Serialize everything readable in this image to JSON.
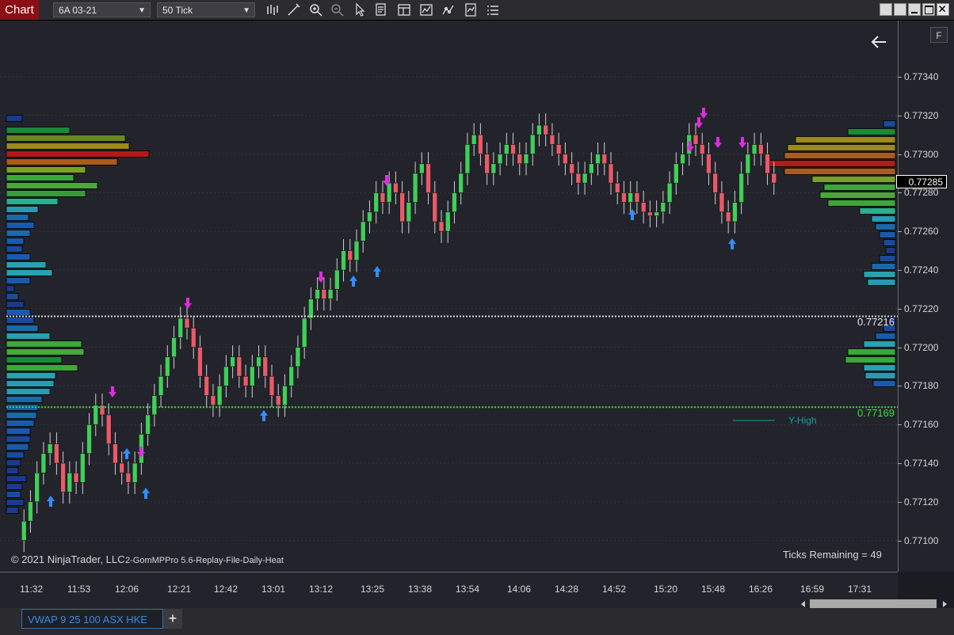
{
  "toolbar": {
    "chart_tab": "Chart",
    "instrument": "6A 03-21",
    "period": "50 Tick"
  },
  "price_axis": {
    "ticks": [
      "0.77340",
      "0.77320",
      "0.77300",
      "0.77280",
      "0.77260",
      "0.77240",
      "0.77220",
      "0.77200",
      "0.77180",
      "0.77160",
      "0.77140",
      "0.77120",
      "0.77100"
    ],
    "current_price": "0.77285",
    "white_line_price": "0.77216",
    "green_line_price": "0.77169",
    "f_button": "F"
  },
  "time_axis": {
    "ticks": [
      "11:32",
      "11:53",
      "12:06",
      "12:21",
      "12:42",
      "13:01",
      "13:12",
      "13:25",
      "13:38",
      "13:54",
      "14:06",
      "14:28",
      "14:52",
      "15:20",
      "15:48",
      "16:26",
      "16:59",
      "17:31"
    ]
  },
  "chart": {
    "copyright": "© 2021 NinjaTrader, LLC",
    "indicator_label": "2-GomMPPro 5.6-Replay-File-Daily-Heat",
    "ticks_remaining": "Ticks Remaining = 49",
    "y_high_label": "Y-High",
    "back_arrow": "left-arrow-icon"
  },
  "bottom": {
    "tab_label": "VWAP 9 25 100  ASX HKE",
    "add_tab": "+"
  },
  "colors": {
    "up_candle": "#3fcf5a",
    "down_candle": "#e85a6a",
    "buy_arrow": "#2f8fff",
    "sell_arrow": "#e02ce0",
    "white_line": "#d8d8d8",
    "green_line": "#2ee82e"
  }
}
